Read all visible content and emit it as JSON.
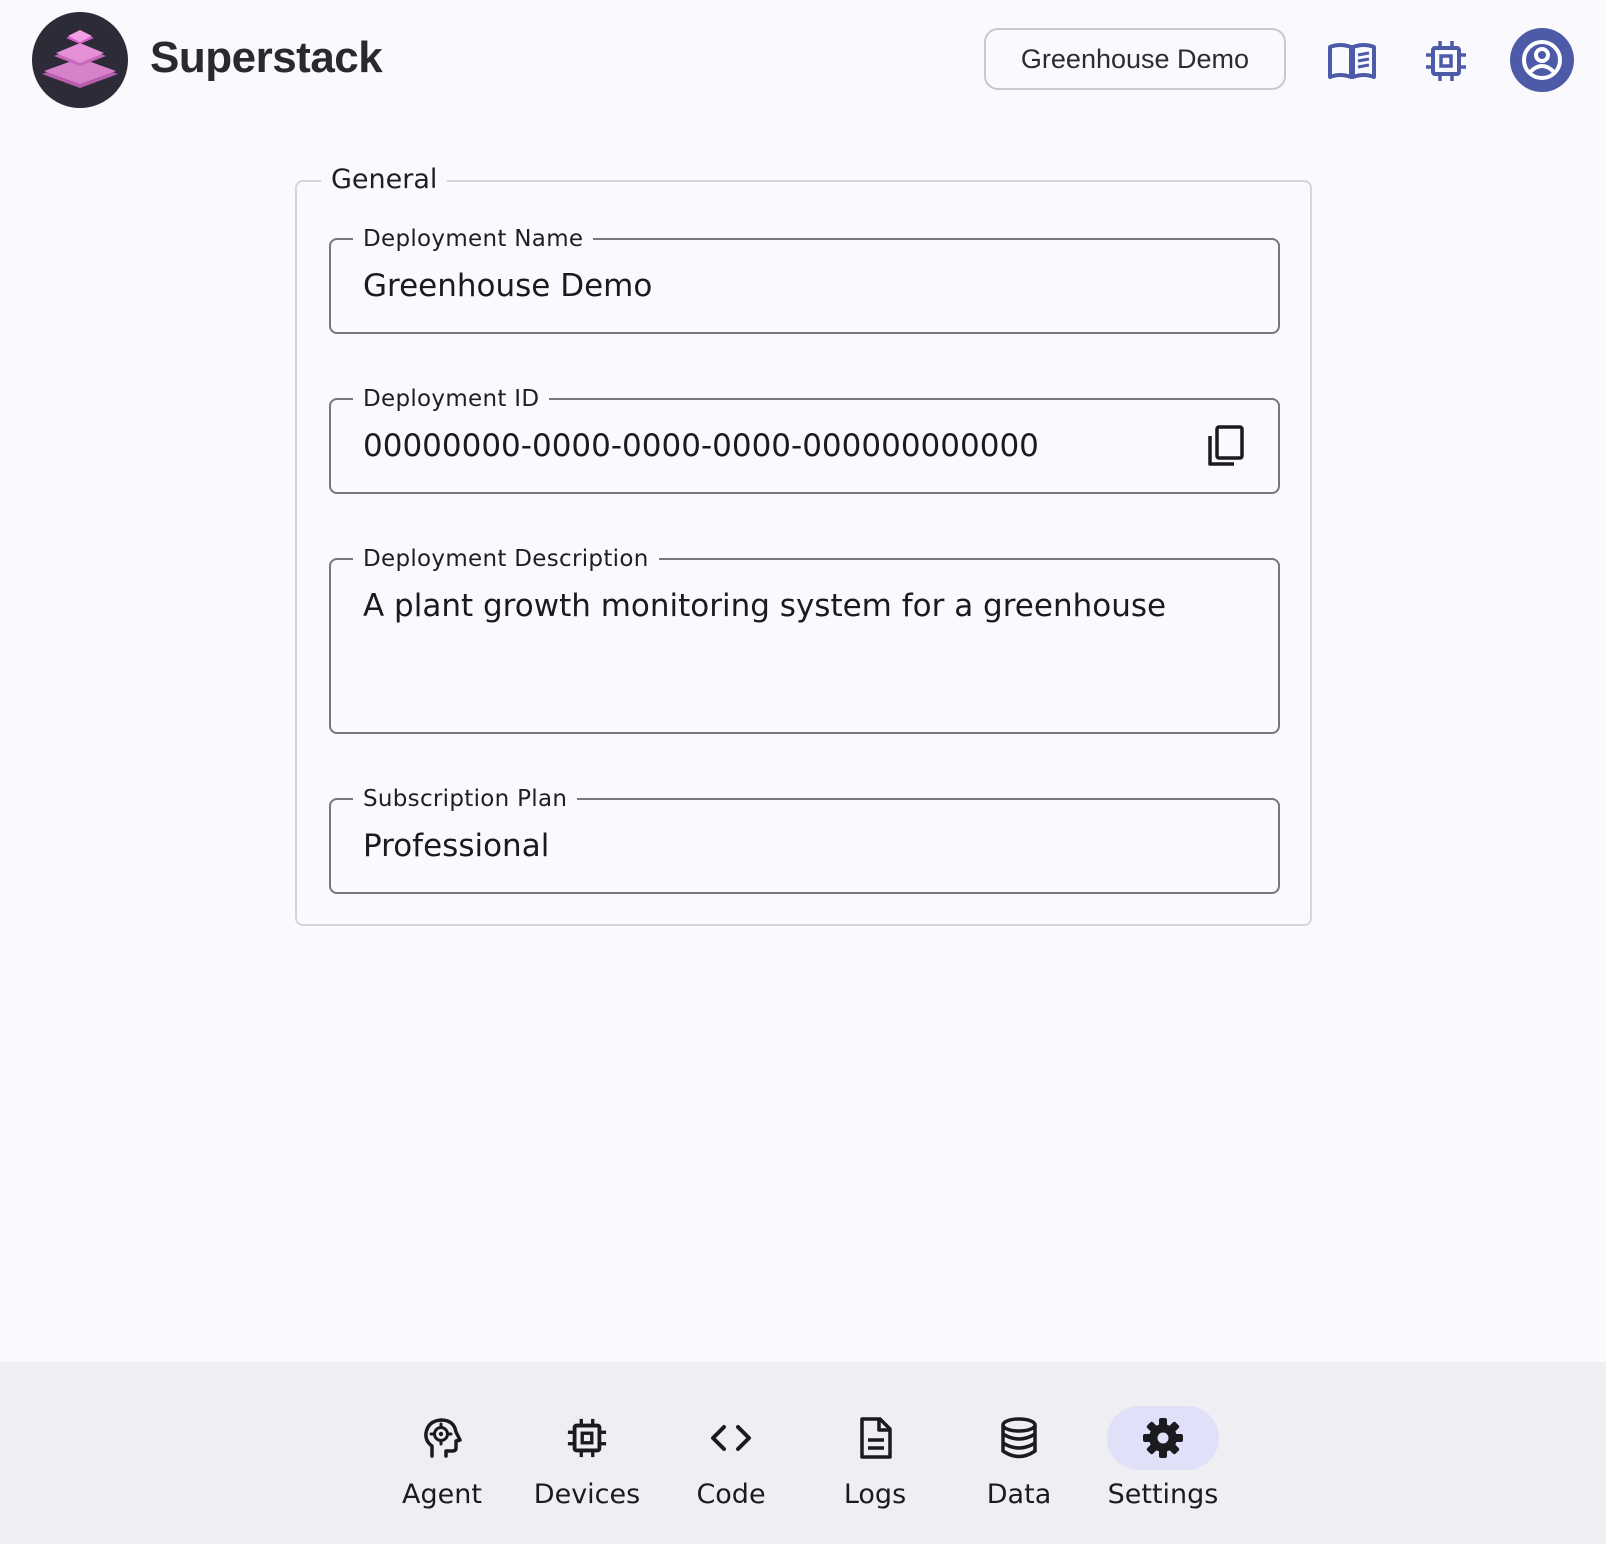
{
  "header": {
    "brand": "Superstack",
    "deployment_button": "Greenhouse Demo",
    "icons": [
      "docs-book-icon",
      "chip-icon",
      "account-icon"
    ]
  },
  "general": {
    "legend": "General",
    "fields": [
      {
        "label": "Deployment Name",
        "value": "Greenhouse Demo"
      },
      {
        "label": "Deployment ID",
        "value": "00000000-0000-0000-0000-000000000000"
      },
      {
        "label": "Deployment Description",
        "value": "A plant growth monitoring system for a greenhouse"
      },
      {
        "label": "Subscription Plan",
        "value": "Professional"
      }
    ]
  },
  "nav": {
    "items": [
      {
        "label": "Agent",
        "icon": "agent-head-gear-icon"
      },
      {
        "label": "Devices",
        "icon": "chip-icon"
      },
      {
        "label": "Code",
        "icon": "code-brackets-icon"
      },
      {
        "label": "Logs",
        "icon": "document-icon"
      },
      {
        "label": "Data",
        "icon": "database-icon"
      },
      {
        "label": "Settings",
        "icon": "gear-icon"
      }
    ],
    "active": "Settings"
  },
  "colors": {
    "background": "#faf9fd",
    "accent": "#4d5aa8",
    "nav_background": "#efeef3",
    "active_pill": "#e0e0f9",
    "logo_dark": "#2c2b37",
    "logo_pink": "#e27bd0"
  }
}
